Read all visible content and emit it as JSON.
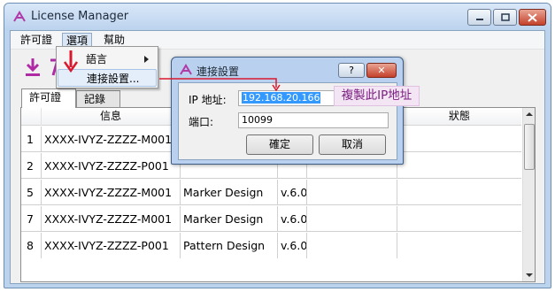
{
  "window": {
    "title": "License Manager",
    "controls": {
      "minimize": "minimize",
      "maximize": "maximize",
      "close": "close"
    }
  },
  "menubar": {
    "items": [
      {
        "label": "許可證"
      },
      {
        "label": "選項"
      },
      {
        "label": "幫助"
      }
    ]
  },
  "options_menu": {
    "items": [
      {
        "label": "語言",
        "has_submenu": true
      },
      {
        "label": "連接設置..."
      }
    ]
  },
  "tabs": [
    {
      "label": "許可證"
    },
    {
      "label": "記錄"
    }
  ],
  "table": {
    "columns": [
      "",
      "信息",
      "",
      "",
      "",
      "狀態"
    ],
    "rows": [
      {
        "num": "1",
        "info": "XXXX-IVYZ-ZZZZ-M001",
        "product": "",
        "version": ""
      },
      {
        "num": "2",
        "info": "XXXX-IVYZ-ZZZZ-P001",
        "product": "",
        "version": ""
      },
      {
        "num": "5",
        "info": "XXXX-IVYZ-ZZZZ-M001",
        "product": "Marker Design",
        "version": "v.6.0"
      },
      {
        "num": "7",
        "info": "XXXX-IVYZ-ZZZZ-M001",
        "product": "Marker Design",
        "version": "v.6.0"
      },
      {
        "num": "8",
        "info": "XXXX-IVYZ-ZZZZ-P001",
        "product": "Pattern Design",
        "version": "v.6.0"
      }
    ]
  },
  "dialog": {
    "title": "連接設置",
    "help_label": "?",
    "close_label": "✕",
    "ip_label": "IP 地址:",
    "ip_value": "192.168.20.166",
    "port_label": "端口:",
    "port_value": "10099",
    "ok_label": "確定",
    "cancel_label": "取消"
  },
  "annotation": {
    "callout_text": "複製此IP地址",
    "accent_color": "#d9182e"
  }
}
